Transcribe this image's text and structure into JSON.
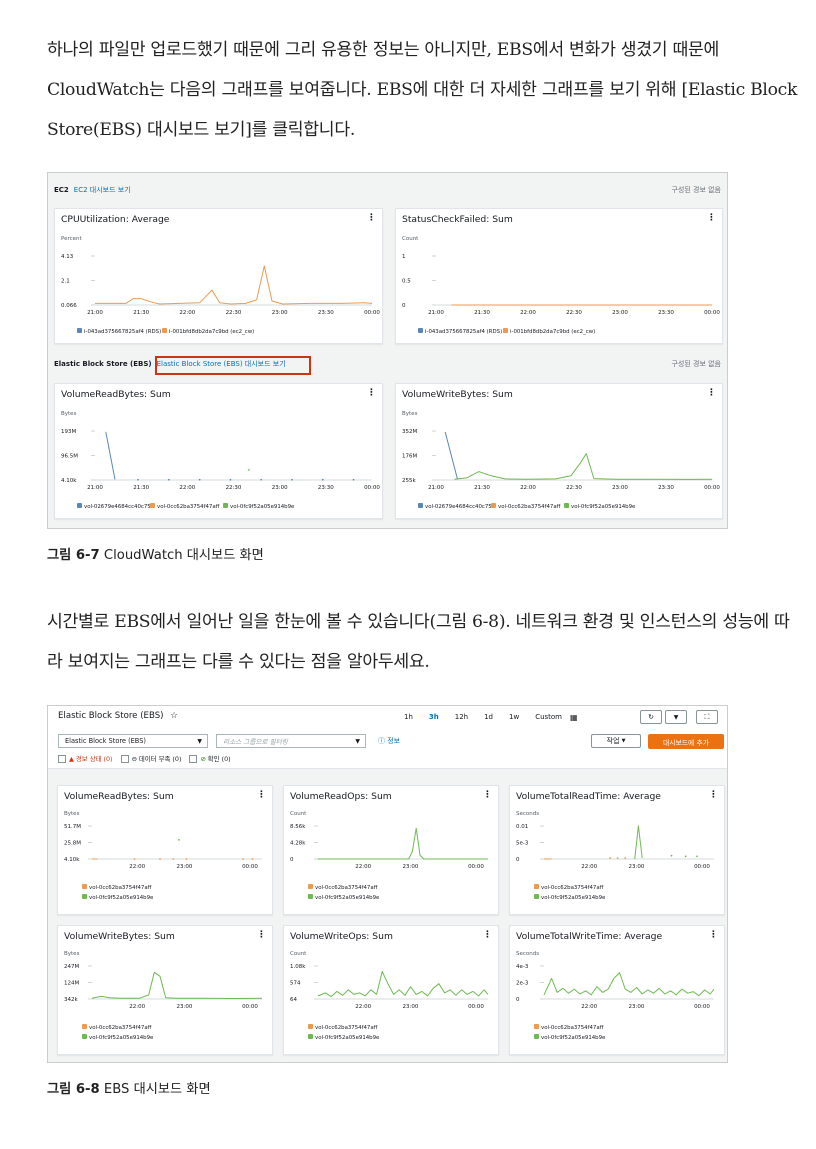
{
  "text": {
    "p1": "하나의 파일만 업로드했기 때문에 그리 유용한 정보는 아니지만, EBS에서 변화가 생겼기 때문에 CloudWatch는 다음의 그래프를 보여줍니다. EBS에 대한 더 자세한 그래프를 보기 위해 [Elastic Block Store(EBS) 대시보드 보기]를 클릭합니다.",
    "cap1_num": "그림 6-7",
    "cap1_text": " CloudWatch 대시보드 화면",
    "p2": "시간별로 EBS에서 일어난 일을 한눈에 볼 수 있습니다(그림 6-8). 네트워크 환경 및 인스턴스의 성능에 따라 보여지는 그래프는 다를 수 있다는 점을 알아두세요.",
    "cap2_num": "그림 6-8",
    "cap2_text": " EBS 대시보드 화면"
  },
  "fig1": {
    "ec2_title": "EC2",
    "ec2_link": "EC2 대시보드 보기",
    "ec2_right": "구성된 경보 없음",
    "ebs_title": "Elastic Block Store (EBS)",
    "ebs_link": "Elastic Block Store (EBS) 대시보드 보기",
    "ebs_right": "구성된 경보 없음",
    "menu_glyph": "⋮"
  },
  "fig2": {
    "title": "Elastic Block Store (EBS)",
    "star": "☆",
    "ranges": [
      "1h",
      "3h",
      "12h",
      "1d",
      "1w",
      "Custom"
    ],
    "selected_range": "3h",
    "select1": "Elastic Block Store (EBS)",
    "select2_placeholder": "리소스 그룹으로 필터링",
    "info": "정보",
    "actions": "작업",
    "add_dashboard": "대시보드에 추가",
    "filter_alarm": "경보 상태 (0)",
    "filter_insufficient": "데이터 부족 (0)",
    "filter_ok": "확인 (0)",
    "refresh_icon": "↻",
    "fullscreen_icon": "⛶",
    "dropdown_icon": "▼"
  },
  "colors": {
    "blue": "#5a87b7",
    "orange": "#ec9a4f",
    "green": "#6dba52",
    "link": "#0073bb",
    "red_highlight": "#d13212",
    "accent_orange": "#ec7211"
  },
  "chart_data": [
    {
      "id": "cpu",
      "type": "line",
      "title": "CPUUtilization: Average",
      "unit": "Percent",
      "y_ticks": [
        "4.13",
        "2.1",
        "0.066"
      ],
      "ylim": [
        0.066,
        4.13
      ],
      "x_ticks": [
        "21:00",
        "21:30",
        "22:00",
        "22:30",
        "23:00",
        "23:30",
        "00:00"
      ],
      "xlim": [
        0,
        180
      ],
      "series": [
        {
          "name": "i-043ad375667825af4 (RDS)",
          "color": "#5a87b7",
          "points": []
        },
        {
          "name": "i-001bfd8db2da7c9bd (ec2_cw)",
          "color": "#ec9a4f",
          "points": [
            [
              0,
              0.2
            ],
            [
              10,
              0.2
            ],
            [
              20,
              0.2
            ],
            [
              25,
              0.6
            ],
            [
              30,
              0.6
            ],
            [
              37,
              0.3
            ],
            [
              42,
              0.15
            ],
            [
              55,
              0.2
            ],
            [
              68,
              0.25
            ],
            [
              76,
              1.3
            ],
            [
              81,
              0.25
            ],
            [
              88,
              0.15
            ],
            [
              98,
              0.2
            ],
            [
              105,
              0.5
            ],
            [
              110,
              3.3
            ],
            [
              115,
              0.4
            ],
            [
              122,
              0.15
            ],
            [
              140,
              0.2
            ],
            [
              160,
              0.2
            ],
            [
              175,
              0.25
            ],
            [
              180,
              0.2
            ]
          ]
        }
      ]
    },
    {
      "id": "status",
      "type": "line",
      "title": "StatusCheckFailed: Sum",
      "unit": "Count",
      "y_ticks": [
        "1",
        "0.5",
        "0"
      ],
      "ylim": [
        0,
        1
      ],
      "x_ticks": [
        "21:00",
        "21:30",
        "22:00",
        "22:30",
        "23:00",
        "23:30",
        "00:00"
      ],
      "xlim": [
        0,
        180
      ],
      "series": [
        {
          "name": "i-043ad375667825af4 (RDS)",
          "color": "#5a87b7",
          "points": []
        },
        {
          "name": "i-001bfd8db2da7c9bd (ec2_cw)",
          "color": "#ec9a4f",
          "points": [
            [
              10,
              0
            ],
            [
              180,
              0
            ]
          ]
        }
      ]
    },
    {
      "id": "vrb",
      "type": "line",
      "title": "VolumeReadBytes: Sum",
      "unit": "Bytes",
      "y_ticks": [
        "193M",
        "96.5M",
        "4.10k"
      ],
      "ylim": [
        0,
        193
      ],
      "x_ticks": [
        "21:00",
        "21:30",
        "22:00",
        "22:30",
        "23:00",
        "23:30",
        "00:00"
      ],
      "xlim": [
        0,
        180
      ],
      "series": [
        {
          "name": "vol-02679e4684cc40c75",
          "color": "#5a87b7",
          "points": [
            [
              7,
              190
            ],
            [
              13,
              2
            ]
          ],
          "dots": [
            [
              28,
              1
            ],
            [
              48,
              1
            ],
            [
              68,
              1
            ],
            [
              88,
              1
            ],
            [
              108,
              1
            ],
            [
              128,
              1
            ],
            [
              148,
              1
            ],
            [
              168,
              1
            ]
          ]
        },
        {
          "name": "vol-0cc62ba3754f47aff",
          "color": "#ec9a4f",
          "points": []
        },
        {
          "name": "vol-0fc9f52a05e914b9e",
          "color": "#6dba52",
          "points": [],
          "dots": [
            [
              100,
              40
            ]
          ]
        }
      ]
    },
    {
      "id": "vwb",
      "type": "line",
      "title": "VolumeWriteBytes: Sum",
      "unit": "Bytes",
      "y_ticks": [
        "352M",
        "176M",
        "255k"
      ],
      "ylim": [
        0,
        352
      ],
      "x_ticks": [
        "21:00",
        "21:30",
        "22:00",
        "22:30",
        "23:00",
        "23:30",
        "00:00"
      ],
      "xlim": [
        0,
        180
      ],
      "series": [
        {
          "name": "vol-02679e4684cc40c75",
          "color": "#5a87b7",
          "points": [
            [
              6,
              345
            ],
            [
              14,
              5
            ]
          ]
        },
        {
          "name": "vol-0cc62ba3754f47aff",
          "color": "#ec9a4f",
          "points": []
        },
        {
          "name": "vol-0fc9f52a05e914b9e",
          "color": "#6dba52",
          "points": [
            [
              12,
              5
            ],
            [
              20,
              15
            ],
            [
              28,
              60
            ],
            [
              36,
              30
            ],
            [
              45,
              8
            ],
            [
              60,
              5
            ],
            [
              78,
              8
            ],
            [
              88,
              30
            ],
            [
              94,
              120
            ],
            [
              98,
              190
            ],
            [
              103,
              10
            ],
            [
              118,
              5
            ],
            [
              140,
              5
            ],
            [
              165,
              4
            ],
            [
              180,
              5
            ]
          ]
        }
      ]
    },
    {
      "id": "e_vrb",
      "type": "line",
      "title": "VolumeReadBytes: Sum",
      "unit": "Bytes",
      "y_ticks": [
        "51.7M",
        "25.8M",
        "4.10k"
      ],
      "ylim": [
        0,
        51.7
      ],
      "x_ticks": [
        "22:00",
        "23:00",
        "00:00"
      ],
      "xlim": [
        0,
        180
      ],
      "series": [
        {
          "name": "vol-0cc62ba3754f47aff",
          "color": "#ec9a4f",
          "points": [
            [
              0,
              0
            ],
            [
              6,
              0
            ]
          ],
          "dots": [
            [
              45,
              0
            ],
            [
              72,
              0
            ],
            [
              86,
              0
            ],
            [
              100,
              0
            ],
            [
              160,
              0
            ],
            [
              170,
              0
            ]
          ]
        },
        {
          "name": "vol-0fc9f52a05e914b9e",
          "color": "#6dba52",
          "points": [],
          "dots": [
            [
              92,
              30
            ]
          ]
        }
      ]
    },
    {
      "id": "e_vro",
      "type": "line",
      "title": "VolumeReadOps: Sum",
      "unit": "Count",
      "y_ticks": [
        "8.56k",
        "4.28k",
        "0"
      ],
      "ylim": [
        0,
        8.56
      ],
      "x_ticks": [
        "22:00",
        "23:00",
        "00:00"
      ],
      "xlim": [
        0,
        180
      ],
      "series": [
        {
          "name": "vol-0cc62ba3754f47aff",
          "color": "#ec9a4f",
          "points": []
        },
        {
          "name": "vol-0fc9f52a05e914b9e",
          "color": "#6dba52",
          "points": [
            [
              0,
              0
            ],
            [
              96,
              0
            ],
            [
              100,
              2
            ],
            [
              104,
              8
            ],
            [
              108,
              1
            ],
            [
              112,
              0
            ],
            [
              180,
              0
            ]
          ]
        }
      ]
    },
    {
      "id": "e_vtrt",
      "type": "line",
      "title": "VolumeTotalReadTime: Average",
      "unit": "Seconds",
      "y_ticks": [
        "0.01",
        "5e-3",
        "0"
      ],
      "ylim": [
        0,
        0.01
      ],
      "x_ticks": [
        "22:00",
        "23:00",
        "00:00"
      ],
      "xlim": [
        0,
        180
      ],
      "series": [
        {
          "name": "vol-0cc62ba3754f47aff",
          "color": "#ec9a4f",
          "points": [
            [
              0,
              0
            ],
            [
              8,
              0
            ]
          ],
          "dots": [
            [
              70,
              0.0003
            ],
            [
              78,
              0.0003
            ],
            [
              86,
              0.0003
            ]
          ]
        },
        {
          "name": "vol-0fc9f52a05e914b9e",
          "color": "#6dba52",
          "points": [
            [
              96,
              0
            ],
            [
              100,
              0.01
            ],
            [
              104,
              0.0003
            ]
          ],
          "dots": [
            [
              135,
              0.001
            ],
            [
              150,
              0.0008
            ],
            [
              162,
              0.0008
            ]
          ]
        }
      ]
    },
    {
      "id": "e_vwb",
      "type": "line",
      "title": "VolumeWriteBytes: Sum",
      "unit": "Bytes",
      "y_ticks": [
        "247M",
        "124M",
        "342k"
      ],
      "ylim": [
        0,
        247
      ],
      "x_ticks": [
        "22:00",
        "23:00",
        "00:00"
      ],
      "xlim": [
        0,
        180
      ],
      "series": [
        {
          "name": "vol-0cc62ba3754f47aff",
          "color": "#ec9a4f",
          "points": []
        },
        {
          "name": "vol-0fc9f52a05e914b9e",
          "color": "#6dba52",
          "points": [
            [
              0,
              5
            ],
            [
              10,
              20
            ],
            [
              18,
              10
            ],
            [
              30,
              5
            ],
            [
              50,
              5
            ],
            [
              60,
              30
            ],
            [
              66,
              200
            ],
            [
              72,
              170
            ],
            [
              78,
              10
            ],
            [
              90,
              5
            ],
            [
              120,
              5
            ],
            [
              150,
              4
            ],
            [
              180,
              5
            ]
          ]
        }
      ]
    },
    {
      "id": "e_vwo",
      "type": "line",
      "title": "VolumeWriteOps: Sum",
      "unit": "Count",
      "y_ticks": [
        "1.08k",
        "574",
        "64"
      ],
      "ylim": [
        0,
        1.08
      ],
      "x_ticks": [
        "22:00",
        "23:00",
        "00:00"
      ],
      "xlim": [
        0,
        180
      ],
      "series": [
        {
          "name": "vol-0cc62ba3754f47aff",
          "color": "#ec9a4f",
          "points": []
        },
        {
          "name": "vol-0fc9f52a05e914b9e",
          "color": "#6dba52",
          "points": [
            [
              0,
              0.1
            ],
            [
              8,
              0.2
            ],
            [
              14,
              0.08
            ],
            [
              20,
              0.25
            ],
            [
              26,
              0.12
            ],
            [
              32,
              0.3
            ],
            [
              38,
              0.15
            ],
            [
              44,
              0.2
            ],
            [
              50,
              0.1
            ],
            [
              56,
              0.3
            ],
            [
              62,
              0.15
            ],
            [
              68,
              0.9
            ],
            [
              74,
              0.5
            ],
            [
              80,
              0.15
            ],
            [
              86,
              0.3
            ],
            [
              92,
              0.12
            ],
            [
              98,
              0.4
            ],
            [
              104,
              0.15
            ],
            [
              110,
              0.25
            ],
            [
              116,
              0.1
            ],
            [
              122,
              0.35
            ],
            [
              128,
              0.5
            ],
            [
              134,
              0.2
            ],
            [
              140,
              0.3
            ],
            [
              146,
              0.12
            ],
            [
              152,
              0.3
            ],
            [
              158,
              0.15
            ],
            [
              164,
              0.25
            ],
            [
              170,
              0.1
            ],
            [
              176,
              0.3
            ],
            [
              180,
              0.15
            ]
          ]
        }
      ]
    },
    {
      "id": "e_vtwt",
      "type": "line",
      "title": "VolumeTotalWriteTime: Average",
      "unit": "Seconds",
      "y_ticks": [
        "4e-3",
        "2e-3",
        "0"
      ],
      "ylim": [
        0,
        0.004
      ],
      "x_ticks": [
        "22:00",
        "23:00",
        "00:00"
      ],
      "xlim": [
        0,
        180
      ],
      "series": [
        {
          "name": "vol-0cc62ba3754f47aff",
          "color": "#ec9a4f",
          "points": []
        },
        {
          "name": "vol-0fc9f52a05e914b9e",
          "color": "#6dba52",
          "points": [
            [
              0,
              0.0005
            ],
            [
              8,
              0.0025
            ],
            [
              14,
              0.0008
            ],
            [
              20,
              0.0013
            ],
            [
              26,
              0.0007
            ],
            [
              32,
              0.0012
            ],
            [
              38,
              0.0006
            ],
            [
              44,
              0.001
            ],
            [
              50,
              0.0005
            ],
            [
              56,
              0.0015
            ],
            [
              62,
              0.0008
            ],
            [
              68,
              0.0012
            ],
            [
              74,
              0.0025
            ],
            [
              80,
              0.0032
            ],
            [
              86,
              0.0012
            ],
            [
              92,
              0.0008
            ],
            [
              98,
              0.0014
            ],
            [
              104,
              0.0006
            ],
            [
              110,
              0.0011
            ],
            [
              116,
              0.0007
            ],
            [
              122,
              0.0013
            ],
            [
              128,
              0.0006
            ],
            [
              134,
              0.001
            ],
            [
              140,
              0.0005
            ],
            [
              146,
              0.0012
            ],
            [
              152,
              0.0007
            ],
            [
              158,
              0.0009
            ],
            [
              164,
              0.0004
            ],
            [
              170,
              0.0011
            ],
            [
              176,
              0.0006
            ],
            [
              180,
              0.0012
            ]
          ]
        }
      ]
    }
  ]
}
